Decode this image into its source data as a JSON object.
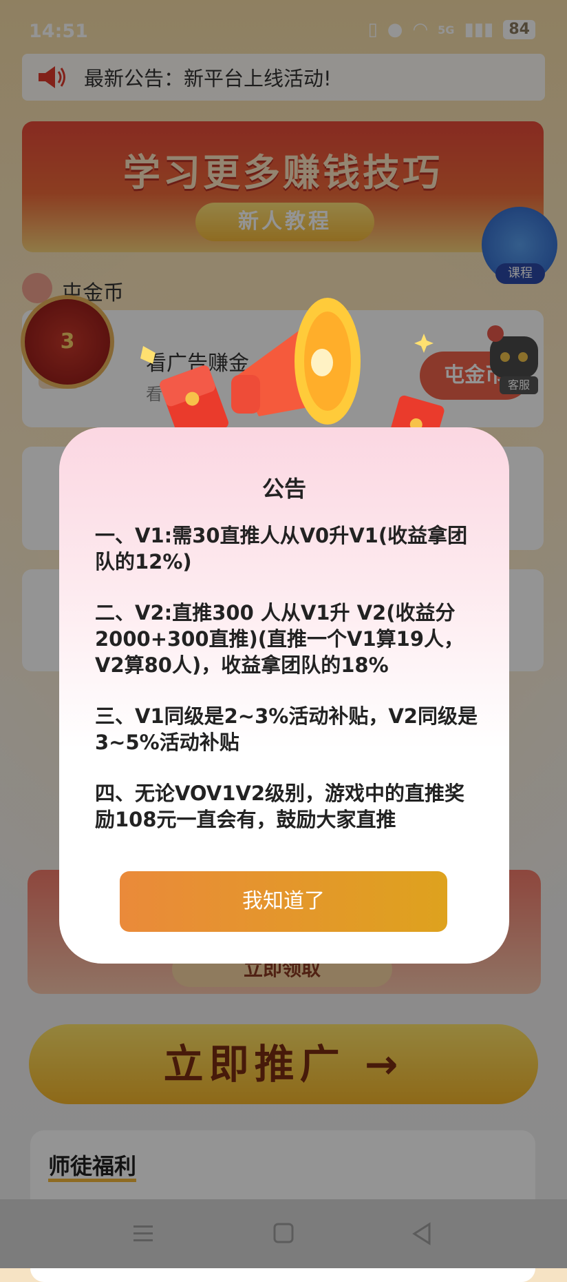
{
  "status_bar": {
    "time": "14:51",
    "network": "5G",
    "battery": "84"
  },
  "notice": {
    "text": "最新公告：新平台上线活动!"
  },
  "banner": {
    "title": "学习更多赚钱技巧",
    "button": "新人教程",
    "course_label": "课程"
  },
  "section": {
    "title": "屯金币"
  },
  "task_card": {
    "title": "看广告赚金",
    "subtitle": "看",
    "button": "屯金币",
    "coin_number": "3"
  },
  "service": {
    "label": "客服"
  },
  "promo": {
    "button": "立即领取"
  },
  "cta": {
    "label": "立即推广 →"
  },
  "mentor": {
    "title": "师徒福利"
  },
  "modal": {
    "title": "公告",
    "paragraphs": [
      "一、V1:需30直推人从V0升V1(收益拿团队的12%)",
      "二、V2:直推300 人从V1升 V2(收益分2000+300直推)(直推一个V1算19人，V2算80人)，收益拿团队的18%",
      "三、V1同级是2~3%活动补贴，V2同级是3~5%活动补贴",
      "四、无论VOV1V2级别，游戏中的直推奖励108元一直会有，鼓励大家直推"
    ],
    "ack_button": "我知道了"
  },
  "colors": {
    "accent": "#e08c30",
    "modal_top": "#fbd7e2",
    "overlay": "rgba(0,0,0,0.42)"
  }
}
